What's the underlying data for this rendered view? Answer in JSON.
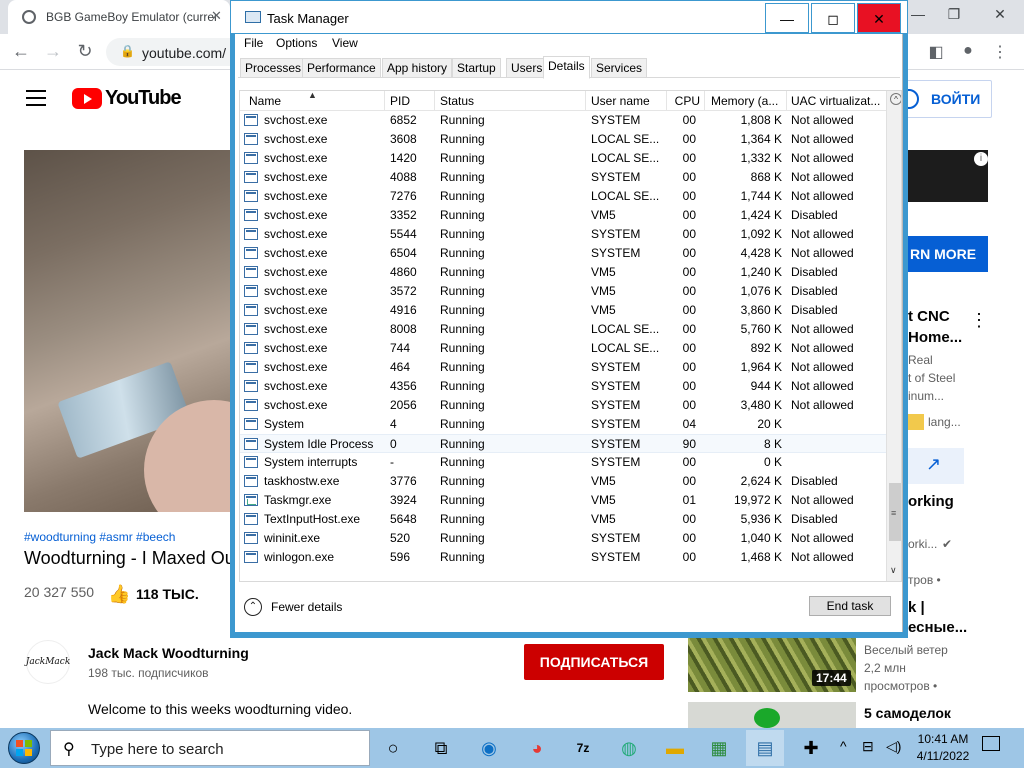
{
  "browser": {
    "tab_title": "BGB GameBoy Emulator (current",
    "url": "youtube.com/",
    "minimize": "—",
    "restore": "❐",
    "close": "✕"
  },
  "youtube": {
    "logo_text": "YouTube",
    "signin_label": "ВОЙТИ",
    "hashtags": "#woodturning #asmr #beech",
    "video_title": "Woodturning - I Maxed Ou",
    "views": "20 327 550",
    "likes": "118 ТЫС.",
    "channel_name": "Jack Mack Woodturning",
    "channel_avatar_text": "JackMack",
    "subscribers": "198 тыс. подписчиков",
    "subscribe_label": "ПОДПИСАТЬСЯ",
    "description": "Welcome to this weeks woodturning video.",
    "sidebar": {
      "ad_info": "i",
      "learn_more": "RN MORE",
      "rec1_title_1": "t CNC",
      "rec1_title_2": "Home...",
      "rec1_sub_1": "Real",
      "rec1_sub_2": "t of Steel",
      "rec1_sub_3": "inum...",
      "rec1_tag": "lang...",
      "rec2_title": "orking",
      "rec2_channel": "orki...",
      "rec2_views": "тров •",
      "rec3_title_1": "k |",
      "rec3_title_2": "есные...",
      "rec3_channel": "Веселый ветер",
      "rec3_views_1": "2,2 млн",
      "rec3_views_2": "просмотров •",
      "rec3_duration": "17:44",
      "rec4_title": "5 самоделок"
    }
  },
  "taskmanager": {
    "title": "Task Manager",
    "menu": [
      "File",
      "Options",
      "View"
    ],
    "tabs": [
      "Processes",
      "Performance",
      "App history",
      "Startup",
      "Users",
      "Details",
      "Services"
    ],
    "active_tab": "Details",
    "columns": [
      "Name",
      "PID",
      "Status",
      "User name",
      "CPU",
      "Memory (a...",
      "UAC virtualizat..."
    ],
    "rows": [
      [
        "svchost.exe",
        "6852",
        "Running",
        "SYSTEM",
        "00",
        "1,808 K",
        "Not allowed"
      ],
      [
        "svchost.exe",
        "3608",
        "Running",
        "LOCAL SE...",
        "00",
        "1,364 K",
        "Not allowed"
      ],
      [
        "svchost.exe",
        "1420",
        "Running",
        "LOCAL SE...",
        "00",
        "1,332 K",
        "Not allowed"
      ],
      [
        "svchost.exe",
        "4088",
        "Running",
        "SYSTEM",
        "00",
        "868 K",
        "Not allowed"
      ],
      [
        "svchost.exe",
        "7276",
        "Running",
        "LOCAL SE...",
        "00",
        "1,744 K",
        "Not allowed"
      ],
      [
        "svchost.exe",
        "3352",
        "Running",
        "VM5",
        "00",
        "1,424 K",
        "Disabled"
      ],
      [
        "svchost.exe",
        "5544",
        "Running",
        "SYSTEM",
        "00",
        "1,092 K",
        "Not allowed"
      ],
      [
        "svchost.exe",
        "6504",
        "Running",
        "SYSTEM",
        "00",
        "4,428 K",
        "Not allowed"
      ],
      [
        "svchost.exe",
        "4860",
        "Running",
        "VM5",
        "00",
        "1,240 K",
        "Disabled"
      ],
      [
        "svchost.exe",
        "3572",
        "Running",
        "VM5",
        "00",
        "1,076 K",
        "Disabled"
      ],
      [
        "svchost.exe",
        "4916",
        "Running",
        "VM5",
        "00",
        "3,860 K",
        "Disabled"
      ],
      [
        "svchost.exe",
        "8008",
        "Running",
        "LOCAL SE...",
        "00",
        "5,760 K",
        "Not allowed"
      ],
      [
        "svchost.exe",
        "744",
        "Running",
        "LOCAL SE...",
        "00",
        "892 K",
        "Not allowed"
      ],
      [
        "svchost.exe",
        "464",
        "Running",
        "SYSTEM",
        "00",
        "1,964 K",
        "Not allowed"
      ],
      [
        "svchost.exe",
        "4356",
        "Running",
        "SYSTEM",
        "00",
        "944 K",
        "Not allowed"
      ],
      [
        "svchost.exe",
        "2056",
        "Running",
        "SYSTEM",
        "00",
        "3,480 K",
        "Not allowed"
      ],
      [
        "System",
        "4",
        "Running",
        "SYSTEM",
        "04",
        "20 K",
        ""
      ],
      [
        "System Idle Process",
        "0",
        "Running",
        "SYSTEM",
        "90",
        "8 K",
        ""
      ],
      [
        "System interrupts",
        "-",
        "Running",
        "SYSTEM",
        "00",
        "0 K",
        ""
      ],
      [
        "taskhostw.exe",
        "3776",
        "Running",
        "VM5",
        "00",
        "2,624 K",
        "Disabled"
      ],
      [
        "Taskmgr.exe",
        "3924",
        "Running",
        "VM5",
        "01",
        "19,972 K",
        "Not allowed"
      ],
      [
        "TextInputHost.exe",
        "5648",
        "Running",
        "VM5",
        "00",
        "5,936 K",
        "Disabled"
      ],
      [
        "wininit.exe",
        "520",
        "Running",
        "SYSTEM",
        "00",
        "1,040 K",
        "Not allowed"
      ],
      [
        "winlogon.exe",
        "596",
        "Running",
        "SYSTEM",
        "00",
        "1,468 K",
        "Not allowed"
      ]
    ],
    "selected_row": "System Idle Process",
    "fewer_details": "Fewer details",
    "end_task": "End task"
  },
  "taskbar": {
    "search_placeholder": "Type here to search",
    "apps": [
      "task-view",
      "edge",
      "chrome",
      "7zip",
      "network",
      "file-explorer",
      "task-manager-perf",
      "task-manager",
      "game-controller"
    ],
    "time": "10:41 AM",
    "date": "4/11/2022"
  }
}
